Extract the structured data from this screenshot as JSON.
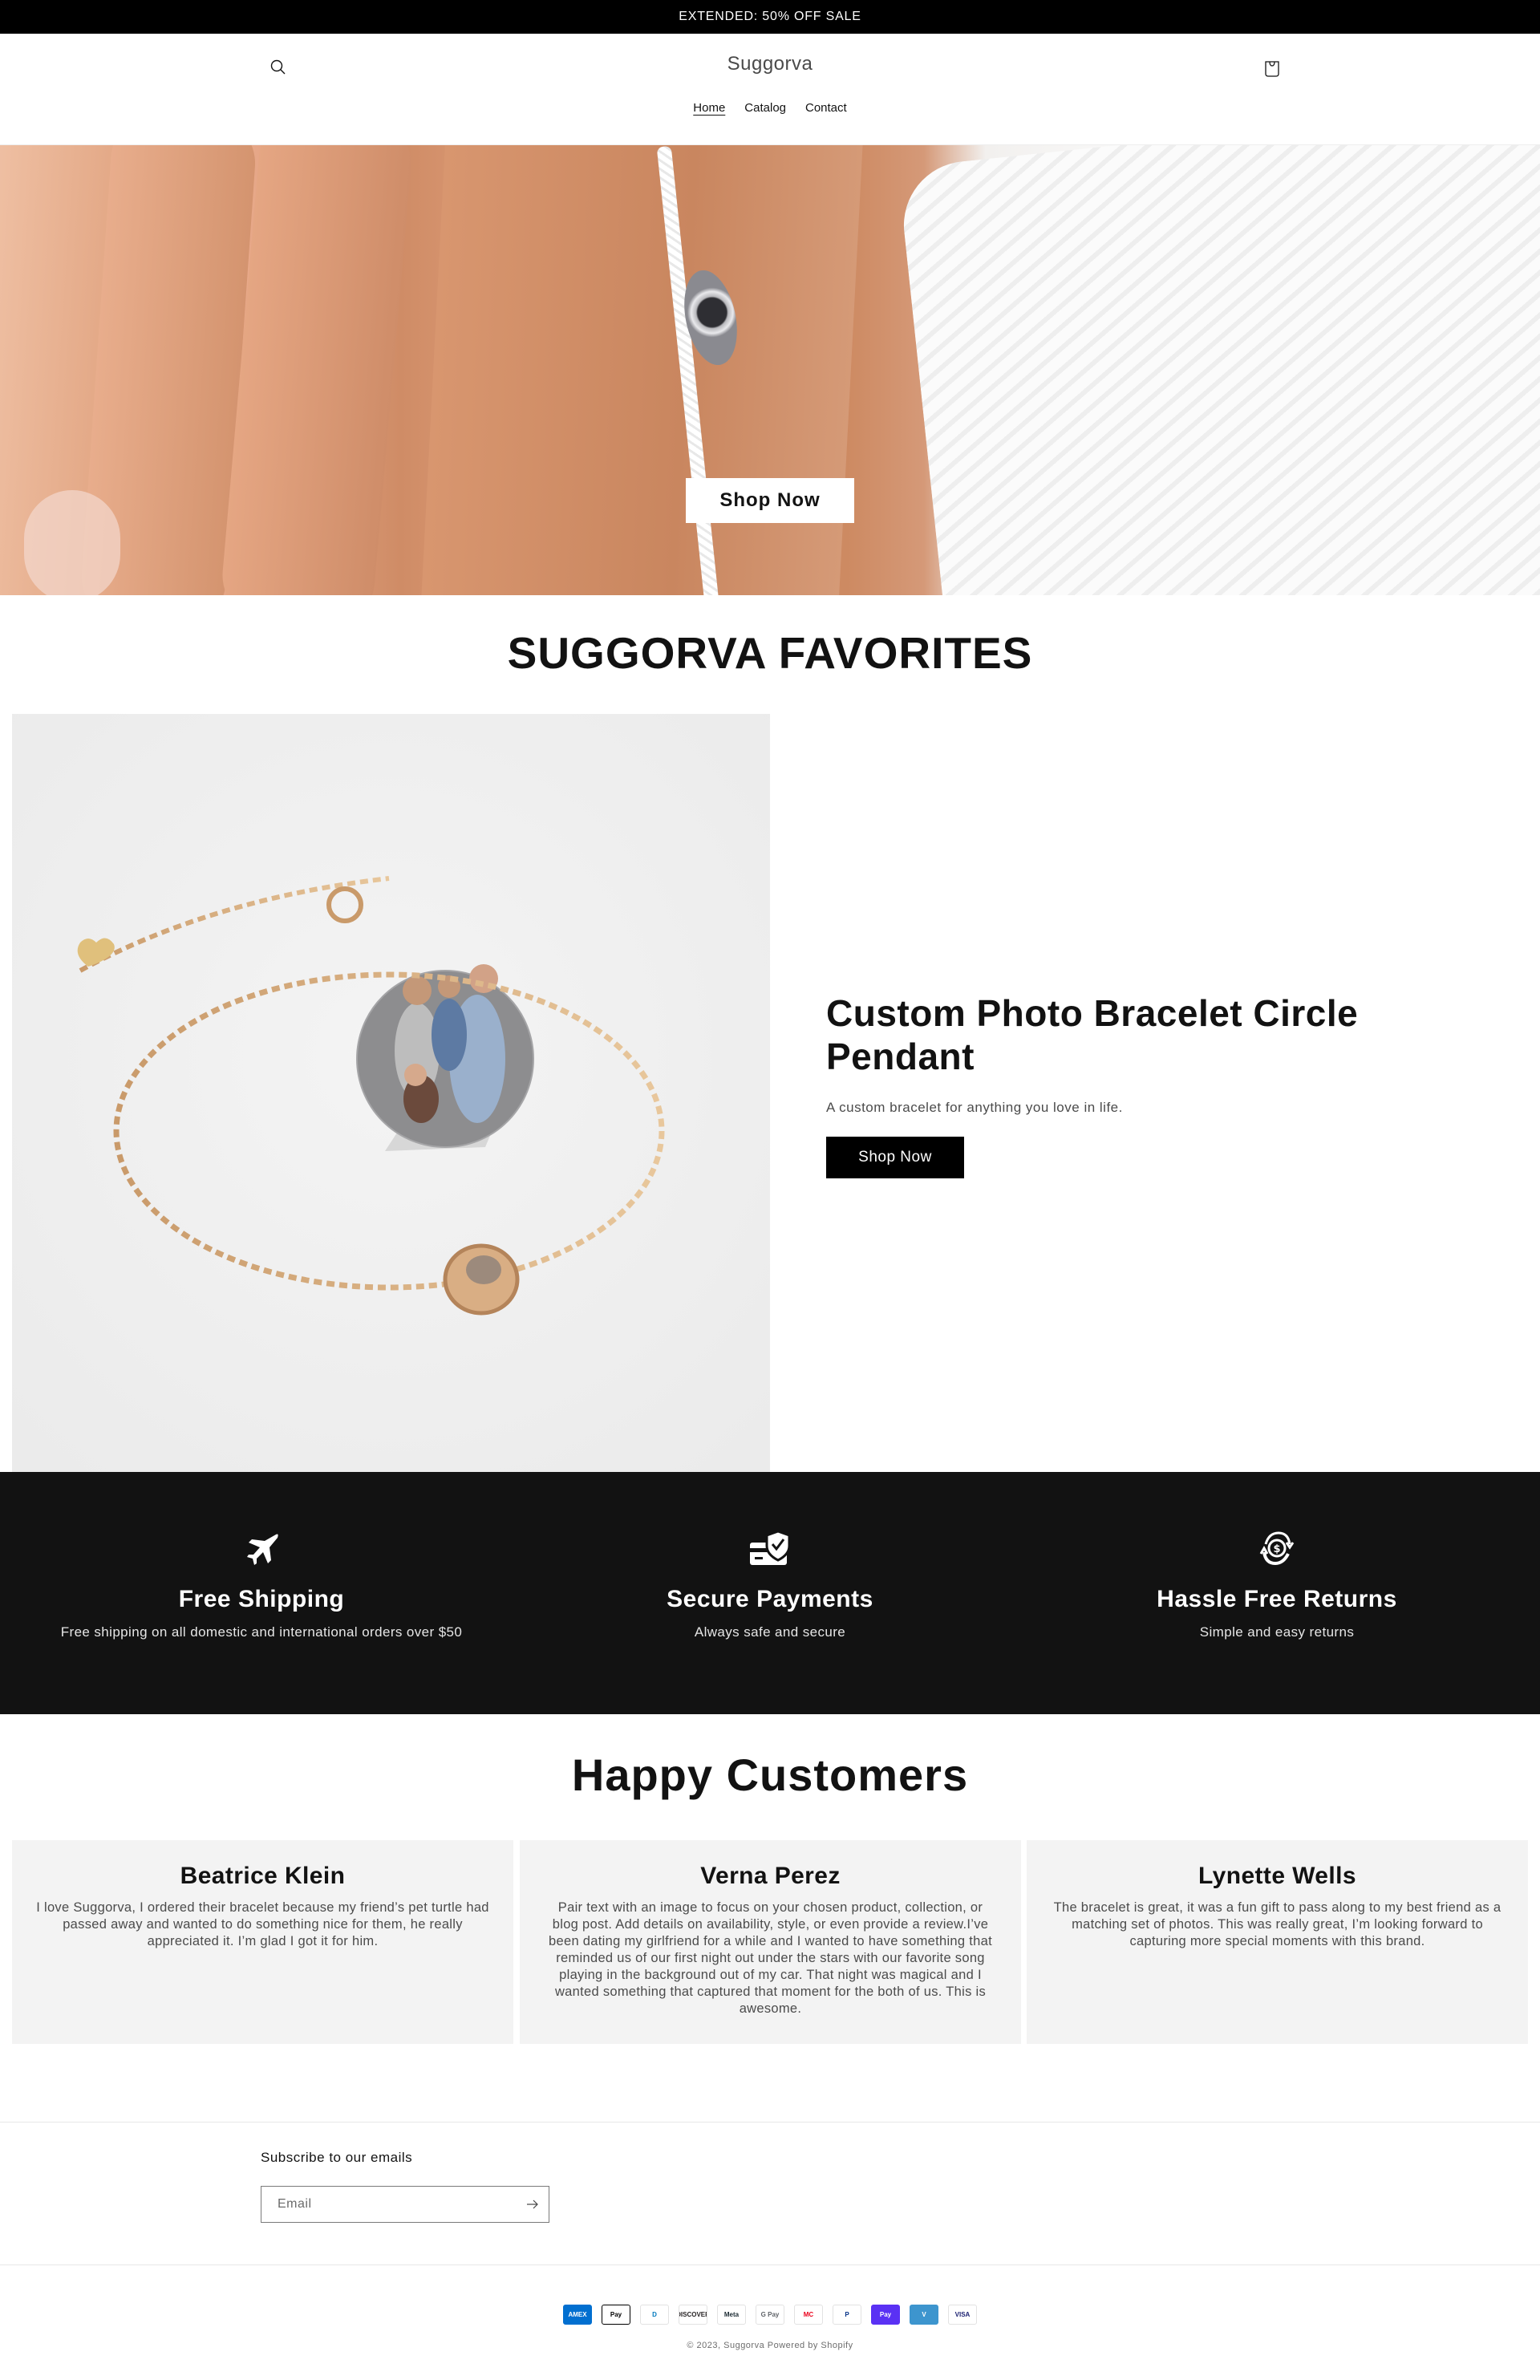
{
  "announcement": "EXTENDED: 50% OFF SALE",
  "header": {
    "logo": "Suggorva",
    "search_icon": "search-icon",
    "cart_icon": "cart-icon",
    "nav": [
      {
        "label": "Home",
        "active": true
      },
      {
        "label": "Catalog",
        "active": false
      },
      {
        "label": "Contact",
        "active": false
      }
    ]
  },
  "hero": {
    "image": "hand-with-projection-bracelet",
    "cta_label": "Shop Now"
  },
  "favorites": {
    "title": "SUGGORVA FAVORITES",
    "product": {
      "image": "custom-photo-bracelet-with-family-projection",
      "title": "Custom Photo Bracelet Circle Pendant",
      "description": "A custom bracelet for anything you love in life.",
      "button_label": "Shop Now"
    }
  },
  "features": [
    {
      "icon": "airplane-icon",
      "title": "Free Shipping",
      "text": "Free shipping on all domestic and international orders over $50"
    },
    {
      "icon": "card-shield-icon",
      "title": "Secure Payments",
      "text": "Always safe and secure"
    },
    {
      "icon": "money-return-icon",
      "title": "Hassle Free Returns",
      "text": "Simple and easy returns"
    }
  ],
  "testimonials": {
    "title": "Happy Customers",
    "items": [
      {
        "name": "Beatrice Klein",
        "text": "I love Suggorva, I ordered their bracelet because my friend’s pet turtle had passed away and wanted to do something nice for them, he really appreciated it. I’m glad I got it for him."
      },
      {
        "name": "Verna Perez",
        "text": "Pair text with an image to focus on your chosen product, collection, or blog post. Add details on availability, style, or even provide a review.I’ve been dating my girlfriend for a while and I wanted to have something that reminded us of our first night out under the stars with our favorite song playing in the background out of my car. That night was magical and I wanted something that captured that moment for the both of us. This is awesome."
      },
      {
        "name": "Lynette Wells",
        "text": "The bracelet is great, it was a fun gift to pass along to my best friend as a matching set of photos. This was really great, I’m looking forward to capturing more special moments with this brand."
      }
    ]
  },
  "newsletter": {
    "label": "Subscribe to our emails",
    "placeholder": "Email",
    "value": "",
    "submit_icon": "arrow-right-icon"
  },
  "footer": {
    "payment_methods": [
      {
        "name": "American Express",
        "short": "AMEX",
        "bg": "#016fd0",
        "fg": "#ffffff"
      },
      {
        "name": "Apple Pay",
        "short": "Pay",
        "bg": "#ffffff",
        "fg": "#000000"
      },
      {
        "name": "Diners Club",
        "short": "D",
        "bg": "#ffffff",
        "fg": "#0079be"
      },
      {
        "name": "Discover",
        "short": "DISCOVER",
        "bg": "#ffffff",
        "fg": "#231f20"
      },
      {
        "name": "Meta Pay",
        "short": "Meta",
        "bg": "#ffffff",
        "fg": "#1c2b33"
      },
      {
        "name": "Google Pay",
        "short": "G Pay",
        "bg": "#ffffff",
        "fg": "#5f6368"
      },
      {
        "name": "Mastercard",
        "short": "MC",
        "bg": "#ffffff",
        "fg": "#eb001b"
      },
      {
        "name": "PayPal",
        "short": "P",
        "bg": "#ffffff",
        "fg": "#003087"
      },
      {
        "name": "Shop Pay",
        "short": "Pay",
        "bg": "#5a31f4",
        "fg": "#ffffff"
      },
      {
        "name": "Venmo",
        "short": "V",
        "bg": "#3d95ce",
        "fg": "#ffffff"
      },
      {
        "name": "Visa",
        "short": "VISA",
        "bg": "#ffffff",
        "fg": "#1a1f71"
      }
    ],
    "copyright": "© 2023, Suggorva Powered by Shopify"
  }
}
